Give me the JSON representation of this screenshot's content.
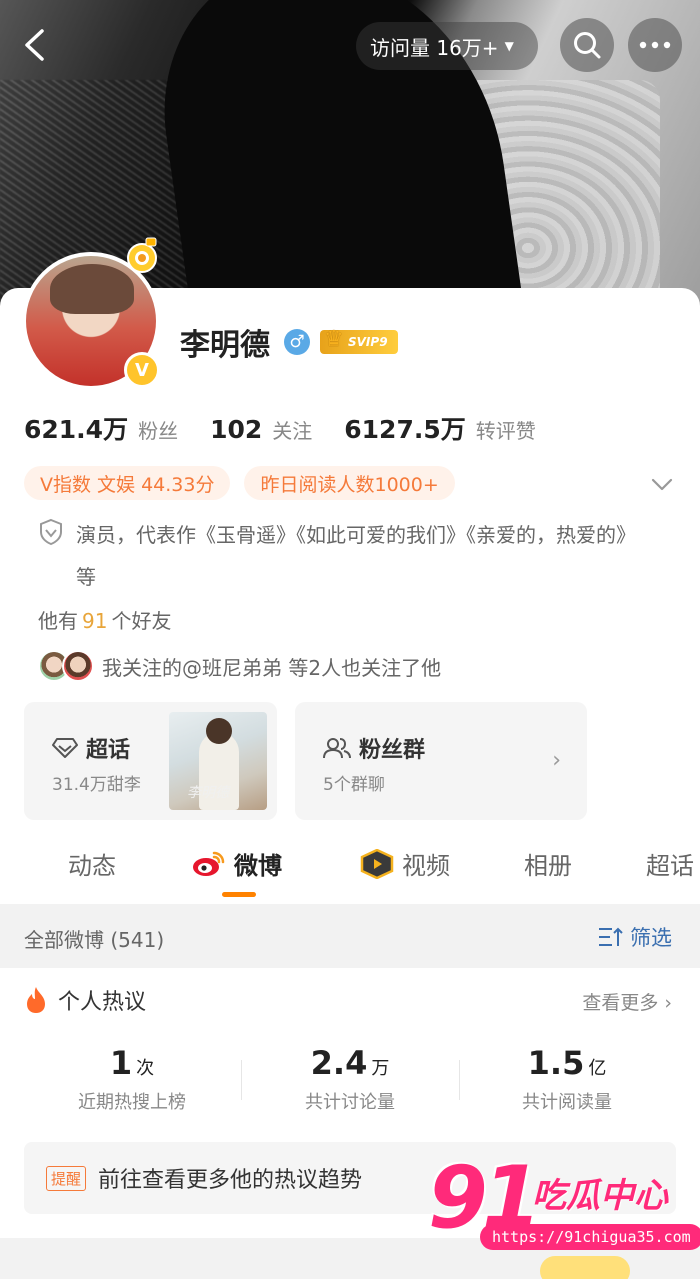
{
  "header": {
    "visits_label": "访问量 16万+"
  },
  "profile": {
    "name": "李明德",
    "gender_symbol": "♂",
    "vip_badge": "SVIP9",
    "v_badge": "V"
  },
  "stats": [
    {
      "value": "621.4万",
      "label": "粉丝"
    },
    {
      "value": "102",
      "label": "关注"
    },
    {
      "value": "6127.5万",
      "label": "转评赞"
    }
  ],
  "chips": [
    "V指数 文娱 44.33分",
    "昨日阅读人数1000+"
  ],
  "bio": "演员，代表作《玉骨遥》《如此可爱的我们》《亲爱的，热爱的》等",
  "friends": {
    "prefix": "他有",
    "count": "91",
    "suffix": "个好友"
  },
  "mutual_follow": "我关注的@班尼弟弟 等2人也关注了他",
  "super_topic": {
    "title": "超话",
    "subtitle": "31.4万甜李",
    "thumb_caption": "李明德"
  },
  "fan_group": {
    "title": "粉丝群",
    "subtitle": "5个群聊"
  },
  "tabs": [
    {
      "label": "动态"
    },
    {
      "label": "微博"
    },
    {
      "label": "视频"
    },
    {
      "label": "相册"
    },
    {
      "label": "超话"
    }
  ],
  "feed": {
    "all_label": "全部微博 (541)",
    "filter_label": "筛选"
  },
  "hot": {
    "title": "个人热议",
    "more_label": "查看更多",
    "stats": [
      {
        "value": "1",
        "unit": "次",
        "label": "近期热搜上榜"
      },
      {
        "value": "2.4",
        "unit": "万",
        "label": "共计讨论量"
      },
      {
        "value": "1.5",
        "unit": "亿",
        "label": "共计阅读量"
      }
    ],
    "trend_tag": "提醒",
    "trend_text": "前往查看更多他的热议趋势"
  },
  "watermark": {
    "number": "91",
    "brand": "吃瓜中心",
    "url": "https://91chigua35.com"
  },
  "colors": {
    "accent": "#ff8200",
    "chip_text": "#f57a3a",
    "link_blue": "#3a6fb0",
    "friends_count": "#e8a53a"
  }
}
